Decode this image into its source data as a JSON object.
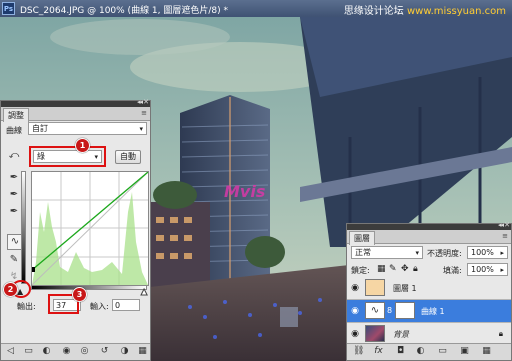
{
  "window": {
    "doc_title": "DSC_2064.JPG @ 100% (曲線 1, 圖層遮色片/8) *",
    "ps_icon": "Ps",
    "watermark_cn": "思缘设计论坛",
    "watermark_url": "www.missyuan.com",
    "canvas_logo": "Mvis"
  },
  "curves_panel": {
    "tab_label": "調整",
    "preset_label": "曲線",
    "preset_value": "自訂",
    "channel_value": "綠",
    "auto_button": "自動",
    "output_label": "輸出:",
    "output_value": "37",
    "input_label": "輸入:",
    "input_value": "0",
    "badges": [
      "1",
      "2",
      "3"
    ],
    "curve_color": "#1ca81c",
    "highlight_color": "#d11111"
  },
  "layers_panel": {
    "tab_label": "圖層",
    "blend_mode": "正常",
    "opacity_label": "不透明度:",
    "opacity_value": "100%",
    "lock_label": "鎖定:",
    "fill_label": "填滿:",
    "fill_value": "100%",
    "layers": [
      {
        "name": "圖層 1",
        "active": false
      },
      {
        "name": "曲線 1",
        "active": true
      },
      {
        "name": "背景",
        "active": false
      }
    ]
  },
  "icons": [
    "photoshop-icon",
    "eye-icon",
    "curve-point-tool-icon",
    "eyedropper-icon",
    "pencil-icon",
    "smooth-icon",
    "link-icon",
    "lock-icon",
    "trash-icon",
    "new-layer-icon"
  ],
  "colors": {
    "selected_layer": "#3b7ddd",
    "titlebar": "#4a5d80"
  }
}
